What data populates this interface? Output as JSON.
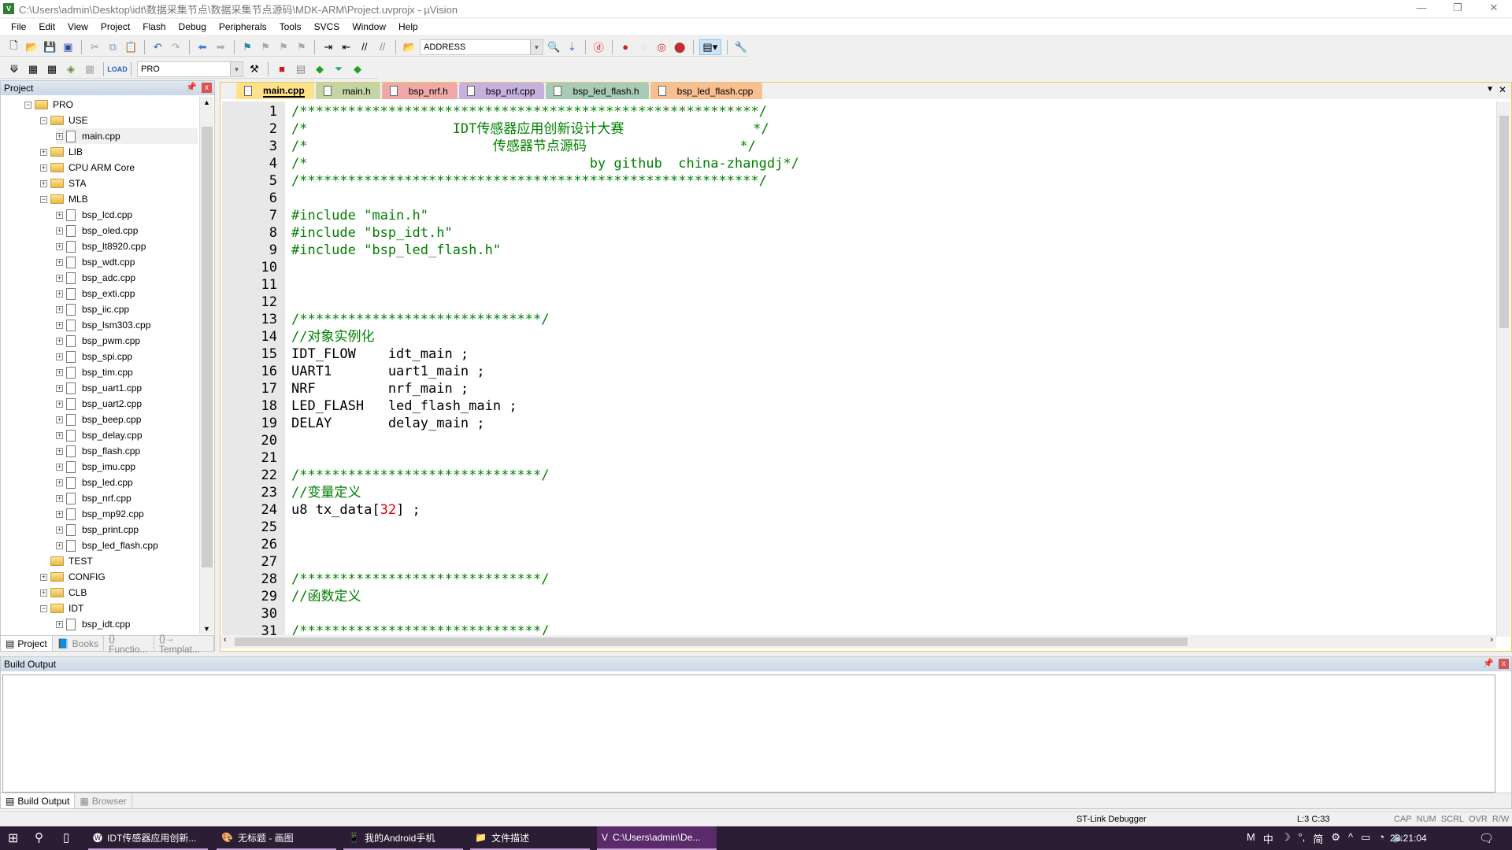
{
  "window": {
    "title": "C:\\Users\\admin\\Desktop\\idt\\数据采集节点\\数据采集节点源码\\MDK-ARM\\Project.uvprojx - µVision"
  },
  "menu": [
    "File",
    "Edit",
    "View",
    "Project",
    "Flash",
    "Debug",
    "Peripherals",
    "Tools",
    "SVCS",
    "Window",
    "Help"
  ],
  "toolbar": {
    "address_label": "ADDRESS",
    "target": "PRO"
  },
  "project_panel": {
    "title": "Project",
    "tree": [
      {
        "label": "PRO",
        "level": 0,
        "type": "root",
        "state": "-"
      },
      {
        "label": "USE",
        "level": 1,
        "type": "folder",
        "state": "-"
      },
      {
        "label": "main.cpp",
        "level": 2,
        "type": "file",
        "state": "+",
        "selected": true
      },
      {
        "label": "LIB",
        "level": 1,
        "type": "folder",
        "state": "+"
      },
      {
        "label": "CPU ARM Core",
        "level": 1,
        "type": "folder",
        "state": "+"
      },
      {
        "label": "STA",
        "level": 1,
        "type": "folder",
        "state": "+"
      },
      {
        "label": "MLB",
        "level": 1,
        "type": "folder",
        "state": "-"
      },
      {
        "label": "bsp_lcd.cpp",
        "level": 2,
        "type": "file",
        "state": "+"
      },
      {
        "label": "bsp_oled.cpp",
        "level": 2,
        "type": "file",
        "state": "+"
      },
      {
        "label": "bsp_lt8920.cpp",
        "level": 2,
        "type": "file",
        "state": "+"
      },
      {
        "label": "bsp_wdt.cpp",
        "level": 2,
        "type": "file",
        "state": "+"
      },
      {
        "label": "bsp_adc.cpp",
        "level": 2,
        "type": "file",
        "state": "+"
      },
      {
        "label": "bsp_exti.cpp",
        "level": 2,
        "type": "file",
        "state": "+"
      },
      {
        "label": "bsp_iic.cpp",
        "level": 2,
        "type": "file",
        "state": "+"
      },
      {
        "label": "bsp_lsm303.cpp",
        "level": 2,
        "type": "file",
        "state": "+"
      },
      {
        "label": "bsp_pwm.cpp",
        "level": 2,
        "type": "file",
        "state": "+"
      },
      {
        "label": "bsp_spi.cpp",
        "level": 2,
        "type": "file",
        "state": "+"
      },
      {
        "label": "bsp_tim.cpp",
        "level": 2,
        "type": "file",
        "state": "+"
      },
      {
        "label": "bsp_uart1.cpp",
        "level": 2,
        "type": "file",
        "state": "+"
      },
      {
        "label": "bsp_uart2.cpp",
        "level": 2,
        "type": "file",
        "state": "+"
      },
      {
        "label": "bsp_beep.cpp",
        "level": 2,
        "type": "file",
        "state": "+"
      },
      {
        "label": "bsp_delay.cpp",
        "level": 2,
        "type": "file",
        "state": "+"
      },
      {
        "label": "bsp_flash.cpp",
        "level": 2,
        "type": "file",
        "state": "+"
      },
      {
        "label": "bsp_imu.cpp",
        "level": 2,
        "type": "file",
        "state": "+"
      },
      {
        "label": "bsp_led.cpp",
        "level": 2,
        "type": "file",
        "state": "+"
      },
      {
        "label": "bsp_nrf.cpp",
        "level": 2,
        "type": "file",
        "state": "+"
      },
      {
        "label": "bsp_mp92.cpp",
        "level": 2,
        "type": "file",
        "state": "+"
      },
      {
        "label": "bsp_print.cpp",
        "level": 2,
        "type": "file",
        "state": "+"
      },
      {
        "label": "bsp_led_flash.cpp",
        "level": 2,
        "type": "file",
        "state": "+"
      },
      {
        "label": "TEST",
        "level": 1,
        "type": "folder",
        "state": ""
      },
      {
        "label": "CONFIG",
        "level": 1,
        "type": "folder",
        "state": "+"
      },
      {
        "label": "CLB",
        "level": 1,
        "type": "folder",
        "state": "+"
      },
      {
        "label": "IDT",
        "level": 1,
        "type": "folder",
        "state": "-"
      },
      {
        "label": "bsp_idt.cpp",
        "level": 2,
        "type": "file",
        "state": "+"
      }
    ],
    "tabs": [
      "Project",
      "Books",
      "{} Functio...",
      "{}→ Templat..."
    ]
  },
  "editor": {
    "tabs": [
      {
        "label": "main.cpp",
        "color": "#fde28a",
        "active": true
      },
      {
        "label": "main.h",
        "color": "#c5d4a4"
      },
      {
        "label": "bsp_nrf.h",
        "color": "#f0a8a8"
      },
      {
        "label": "bsp_nrf.cpp",
        "color": "#c5b0e0"
      },
      {
        "label": "bsp_led_flash.h",
        "color": "#a8cbb8"
      },
      {
        "label": "bsp_led_flash.cpp",
        "color": "#f8c090"
      }
    ],
    "lines": [
      [
        [
          "cm",
          "/*********************************************************/"
        ]
      ],
      [
        [
          "cm",
          "/*                  IDT传感器应用创新设计大赛                */"
        ]
      ],
      [
        [
          "cm",
          "/*                       传感器节点源码                   */"
        ]
      ],
      [
        [
          "cm",
          "/*                                   by github  china-zhangdj*/"
        ]
      ],
      [
        [
          "cm",
          "/*********************************************************/"
        ]
      ],
      [],
      [
        [
          "cm",
          "#include \"main.h\""
        ]
      ],
      [
        [
          "cm",
          "#include \"bsp_idt.h\""
        ]
      ],
      [
        [
          "cm",
          "#include \"bsp_led_flash.h\""
        ]
      ],
      [],
      [],
      [],
      [
        [
          "cm",
          "/******************************/"
        ]
      ],
      [
        [
          "cm",
          "//对象实例化"
        ]
      ],
      [
        [
          "",
          "IDT_FLOW    idt_main ;"
        ]
      ],
      [
        [
          "",
          "UART1       uart1_main ;"
        ]
      ],
      [
        [
          "",
          "NRF         nrf_main ;"
        ]
      ],
      [
        [
          "",
          "LED_FLASH   led_flash_main ;"
        ]
      ],
      [
        [
          "",
          "DELAY       delay_main ;"
        ]
      ],
      [],
      [],
      [
        [
          "cm",
          "/******************************/"
        ]
      ],
      [
        [
          "cm",
          "//变量定义"
        ]
      ],
      [
        [
          "",
          "u8 tx_data["
        ],
        [
          "num",
          "32"
        ],
        [
          "",
          "] ;"
        ]
      ],
      [],
      [],
      [],
      [
        [
          "cm",
          "/******************************/"
        ]
      ],
      [
        [
          "cm",
          "//函数定义"
        ]
      ],
      [],
      [
        [
          "cm",
          "/******************************/"
        ]
      ]
    ]
  },
  "build_output": {
    "title": "Build Output",
    "tabs": [
      "Build Output",
      "Browser"
    ]
  },
  "status": {
    "debugger": "ST-Link Debugger",
    "position": "L:3 C:33",
    "indicators": [
      "CAP",
      "NUM",
      "SCRL",
      "OVR",
      "R/W"
    ]
  },
  "taskbar": {
    "items": [
      "IDT传感器应用创新...",
      "无标题 - 画图",
      "我的Android手机",
      "文件描述",
      "C:\\Users\\admin\\De..."
    ],
    "tray": [
      "M",
      "中",
      "☽",
      "°,",
      "简",
      "⚙",
      "^",
      "▭",
      "◔",
      "🔈"
    ],
    "clock": "23:21:04"
  }
}
